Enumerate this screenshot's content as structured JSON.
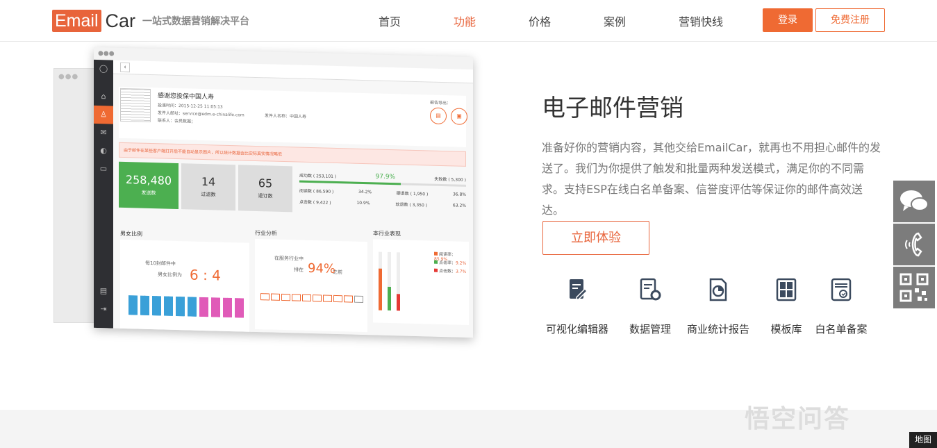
{
  "header": {
    "logo_box": "Email",
    "logo_car": "Car",
    "slogan": "一站式数据营销解决平台",
    "nav": [
      "首页",
      "功能",
      "价格",
      "案例",
      "营销快线"
    ],
    "active_nav": "功能",
    "login": "登录",
    "register": "免费注册"
  },
  "mockup": {
    "email_title": "感谢您投保中国人寿",
    "send_time": "投递时间：2015-12-25 11:05:13",
    "sender_email": "发件人邮址：service@edm.e-chinalife.com",
    "sender_name": "发件人名称：中国人寿",
    "contact": "联系人：会员数据；",
    "export_label": "报告导出：",
    "alert": "由于邮件在某些客户端打开后不能自动显示图片，所以统计数据会比实际真实情况略低",
    "stats": [
      {
        "value": "258,480",
        "label": "发送数"
      },
      {
        "value": "14",
        "label": "过滤数"
      },
      {
        "value": "65",
        "label": "退订数"
      }
    ],
    "success": "成功数 ( 253,101 )",
    "success_pct": "97.9%",
    "success_fraction": 0.979,
    "fail": "失败数 ( 5,300 )",
    "rows": [
      {
        "a": "阅读数 ( 86,590 )",
        "ap": "34.2%",
        "b": "硬退数 ( 1,950 )",
        "bp": "36.8%"
      },
      {
        "a": "点击数 ( 9,422 )",
        "ap": "10.9%",
        "b": "软退数 ( 3,350 )",
        "bp": "63.2%"
      }
    ],
    "gender_title": "男女比例",
    "gender_line1": "每10封邮件中",
    "gender_line2": "男女比例为",
    "gender_ratio": "6 : 4",
    "industry_title": "行业分析",
    "industry_line1": "在服务行业中",
    "industry_rank": "排在",
    "industry_pct": "94%",
    "industry_after": "之前",
    "perf_title": "本行业表现",
    "perf_legend": [
      {
        "k": "阅读率：",
        "v": "85.9%",
        "color": "#ef6a33"
      },
      {
        "k": "点击率：",
        "v": "9.2%",
        "color": "#4caf50"
      },
      {
        "k": "点击数：",
        "v": "3.7%",
        "color": "#e53935"
      }
    ]
  },
  "content": {
    "title": "电子邮件营销",
    "description": "准备好你的营销内容，其他交给EmailCar，就再也不用担心邮件的发送了。我们为你提供了触发和批量两种发送模式，满足你的不同需求。支持ESP在线白名单备案、信誉度评估等保证你的邮件高效送达。",
    "cta": "立即体验",
    "features": [
      {
        "label": "可视化编辑器",
        "icon": "edit-doc-icon"
      },
      {
        "label": "数据管理",
        "icon": "doc-gear-icon"
      },
      {
        "label": "商业统计报告",
        "icon": "pie-report-icon"
      },
      {
        "label": "模板库",
        "icon": "template-icon"
      },
      {
        "label": "白名单备案",
        "icon": "whitelist-icon"
      }
    ]
  },
  "side": {
    "map_tag": "地图"
  },
  "watermark": "悟空问答",
  "colors": {
    "accent": "#ef6a33",
    "green": "#4caf50",
    "float": "#7c7c7c"
  }
}
